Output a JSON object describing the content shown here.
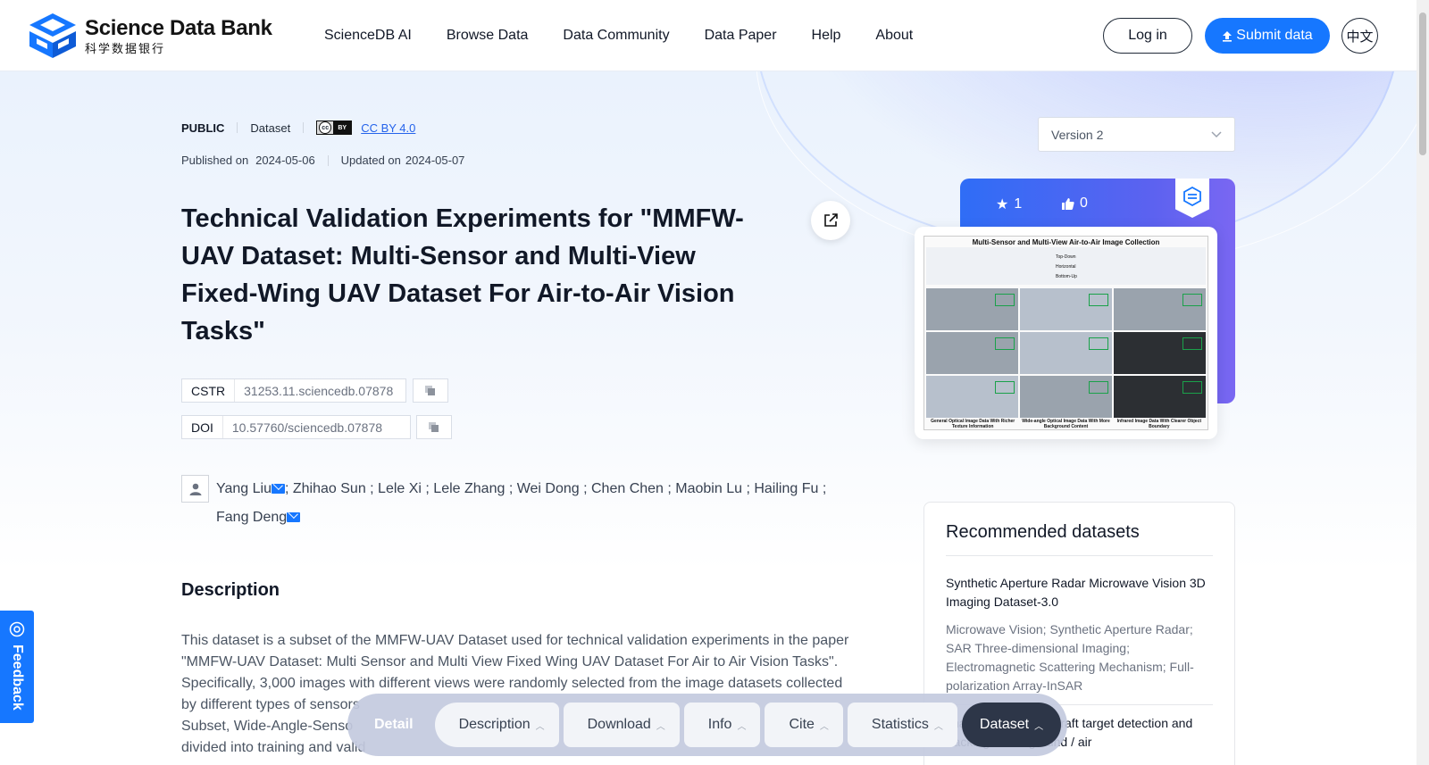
{
  "header": {
    "logo_en": "Science Data Bank",
    "logo_cn": "科学数据银行",
    "nav": [
      "ScienceDB AI",
      "Browse Data",
      "Data Community",
      "Data Paper",
      "Help",
      "About"
    ],
    "login_label": "Log in",
    "submit_label": "Submit data",
    "lang_label": "中文"
  },
  "meta": {
    "visibility": "PUBLIC",
    "type": "Dataset",
    "license": "CC BY 4.0",
    "published_label": "Published on",
    "published_date": "2024-05-06",
    "updated_label": "Updated on",
    "updated_date": "2024-05-07"
  },
  "title": "Technical Validation Experiments for \"MMFW-UAV Dataset: Multi-Sensor and Multi-View Fixed-Wing UAV Dataset For Air-to-Air Vision Tasks\"",
  "identifiers": {
    "cstr_key": "CSTR",
    "cstr_value": "31253.11.sciencedb.07878",
    "doi_key": "DOI",
    "doi_value": "10.57760/sciencedb.07878"
  },
  "authors": {
    "a1": "Yang Liu",
    "rest_line1": "; Zhihao Sun ; Lele Xi ; Lele Zhang ; Wei Dong ; Chen Chen ; Maobin Lu ; Hailing Fu ;",
    "a_last": "Fang Deng"
  },
  "description": {
    "heading": "Description",
    "line1": "This dataset is a subset of the MMFW-UAV Dataset used for technical validation experiments in the paper",
    "line2": "\"MMFW-UAV Dataset: Multi Sensor and Multi View Fixed Wing UAV Dataset For Air to Air Vision Tasks\".",
    "line3": "Specifically, 3,000 images with different views were randomly selected from the image datasets collected",
    "line4": "by different types of sensors",
    "line5": "Subset, Wide-Angle-Senso",
    "line6": "divided into training and valid"
  },
  "sidebar": {
    "version": "Version 2",
    "stars": "1",
    "likes": "0",
    "preview": {
      "title": "Multi-Sensor and Multi-View Air-to-Air Image Collection",
      "view_labels": [
        "Top-Down",
        "Horizontal",
        "Bottom-Up"
      ],
      "captions": [
        "General Optical Image Data With Richer Texture Information",
        "Wide-angle Optical Image Data With More Background Content",
        "Infrared Image Data With Clearer Object Boundary"
      ]
    },
    "recommended": {
      "heading": "Recommended datasets",
      "item1_title": "Synthetic Aperture Radar Microwave Vision 3D Imaging Dataset-3.0",
      "item1_tags": "Microwave Vision; Synthetic Aperture Radar; SAR Three-dimensional Imaging; Electromagnetic Scattering Mechanism; Full-polarization Array-InSAR",
      "item2_title_partial": "image dim-small aircraft target detection and tracking under ground / air"
    }
  },
  "feedback_label": "Feedback",
  "tabbar": {
    "detail": "Detail",
    "tabs": [
      "Description",
      "Download",
      "Info",
      "Cite",
      "Statistics",
      "Dataset"
    ]
  },
  "colors": {
    "primary": "#1677ff",
    "active_tab": "#2d3648",
    "stat_card_start": "#2f6df6",
    "stat_card_end": "#7a67f2"
  }
}
